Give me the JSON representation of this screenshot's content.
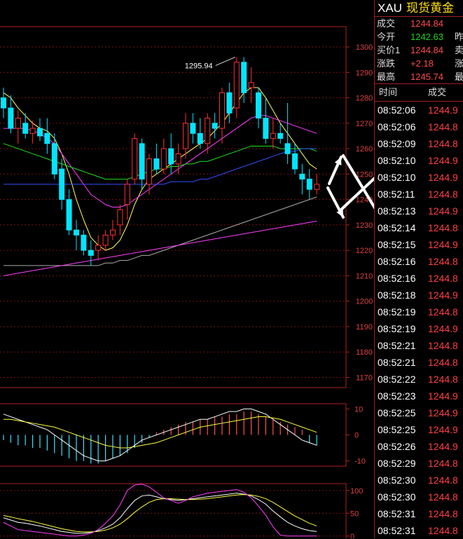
{
  "chart_data": [
    {
      "type": "candlestick",
      "symbol": "XAU",
      "price_axis_ticks": [
        1300,
        1290,
        1280,
        1270,
        1260,
        1250,
        1240,
        1230,
        1220,
        1210,
        1200,
        1190,
        1180,
        1170
      ],
      "ylim": [
        1166,
        1308
      ],
      "annotation": "1295.94",
      "candles": [
        [
          1280,
          1284,
          1272,
          1276
        ],
        [
          1276,
          1281,
          1266,
          1268
        ],
        [
          1268,
          1275,
          1262,
          1272
        ],
        [
          1270,
          1274,
          1264,
          1266
        ],
        [
          1266,
          1271,
          1262,
          1268
        ],
        [
          1268,
          1272,
          1263,
          1265
        ],
        [
          1266,
          1272,
          1258,
          1262
        ],
        [
          1262,
          1266,
          1248,
          1250
        ],
        [
          1252,
          1256,
          1236,
          1240
        ],
        [
          1240,
          1244,
          1226,
          1228
        ],
        [
          1228,
          1232,
          1220,
          1226
        ],
        [
          1226,
          1228,
          1218,
          1220
        ],
        [
          1220,
          1224,
          1214,
          1218
        ],
        [
          1220,
          1226,
          1216,
          1222
        ],
        [
          1222,
          1228,
          1220,
          1226
        ],
        [
          1226,
          1232,
          1224,
          1228
        ],
        [
          1230,
          1238,
          1226,
          1236
        ],
        [
          1238,
          1248,
          1232,
          1246
        ],
        [
          1248,
          1266,
          1246,
          1264
        ],
        [
          1262,
          1264,
          1244,
          1248
        ],
        [
          1246,
          1258,
          1242,
          1256
        ],
        [
          1256,
          1262,
          1250,
          1252
        ],
        [
          1252,
          1264,
          1250,
          1260
        ],
        [
          1260,
          1266,
          1250,
          1254
        ],
        [
          1254,
          1262,
          1250,
          1258
        ],
        [
          1260,
          1274,
          1256,
          1270
        ],
        [
          1270,
          1274,
          1262,
          1266
        ],
        [
          1266,
          1272,
          1260,
          1262
        ],
        [
          1262,
          1274,
          1258,
          1272
        ],
        [
          1270,
          1274,
          1264,
          1268
        ],
        [
          1268,
          1284,
          1262,
          1282
        ],
        [
          1282,
          1286,
          1270,
          1274
        ],
        [
          1276,
          1296,
          1272,
          1294
        ],
        [
          1294,
          1296,
          1278,
          1282
        ],
        [
          1284,
          1292,
          1278,
          1286
        ],
        [
          1282,
          1284,
          1268,
          1272
        ],
        [
          1272,
          1280,
          1262,
          1264
        ],
        [
          1264,
          1272,
          1260,
          1266
        ],
        [
          1266,
          1270,
          1262,
          1264
        ],
        [
          1262,
          1278,
          1254,
          1258
        ],
        [
          1258,
          1262,
          1250,
          1252
        ],
        [
          1250,
          1254,
          1242,
          1248
        ],
        [
          1248,
          1252,
          1240,
          1244
        ],
        [
          1244,
          1250,
          1242,
          1246
        ]
      ],
      "moving_averages": [
        {
          "color": "#ffff66",
          "values": [
            1282,
            1280,
            1276,
            1273,
            1270,
            1268,
            1267,
            1264,
            1258,
            1250,
            1240,
            1232,
            1225,
            1222,
            1220,
            1221,
            1224,
            1230,
            1238,
            1244,
            1248,
            1250,
            1252,
            1254,
            1256,
            1258,
            1260,
            1262,
            1264,
            1267,
            1270,
            1274,
            1278,
            1282,
            1284,
            1284,
            1280,
            1275,
            1270,
            1266,
            1262,
            1258,
            1254,
            1252
          ]
        },
        {
          "color": "#ff40ff",
          "values": [
            1268,
            1268,
            1268,
            1268,
            1267,
            1266,
            1264,
            1262,
            1258,
            1254,
            1250,
            1246,
            1242,
            1240,
            1238,
            1237,
            1237,
            1238,
            1240,
            1242,
            1244,
            1246,
            1248,
            1250,
            1252,
            1254,
            1256,
            1258,
            1260,
            1262,
            1264,
            1266,
            1268,
            1270,
            1272,
            1273,
            1273,
            1272,
            1271,
            1270,
            1269,
            1268,
            1267,
            1266
          ]
        },
        {
          "color": "#20e020",
          "values": [
            1262,
            1261,
            1260,
            1259,
            1258,
            1257,
            1256,
            1255,
            1254,
            1253,
            1252,
            1251,
            1250,
            1249,
            1248,
            1248,
            1248,
            1248,
            1249,
            1250,
            1251,
            1252,
            1252,
            1253,
            1253,
            1254,
            1254,
            1255,
            1255,
            1256,
            1257,
            1258,
            1259,
            1260,
            1261,
            1261,
            1261,
            1261,
            1260,
            1260,
            1260,
            1260,
            1260,
            1259
          ]
        },
        {
          "color": "#3050ff",
          "values": [
            1246,
            1246,
            1246,
            1246,
            1246,
            1246,
            1246,
            1246,
            1246,
            1246,
            1246,
            1246,
            1246,
            1246,
            1246,
            1246,
            1246,
            1246,
            1246,
            1246,
            1246,
            1246,
            1246,
            1247,
            1247,
            1247,
            1247,
            1248,
            1248,
            1249,
            1250,
            1251,
            1252,
            1253,
            1254,
            1255,
            1256,
            1257,
            1258,
            1259,
            1259,
            1260,
            1260,
            1260
          ]
        },
        {
          "color": "#aaaaaa",
          "values": [
            1214,
            1214,
            1214,
            1214,
            1214,
            1214,
            1214,
            1214,
            1214,
            1214,
            1214,
            1214,
            1214,
            1214,
            1215,
            1215,
            1216,
            1216,
            1217,
            1218,
            1218,
            1219,
            1220,
            1221,
            1222,
            1223,
            1224,
            1225,
            1226,
            1227,
            1228,
            1229,
            1230,
            1231,
            1232,
            1233,
            1234,
            1235,
            1236,
            1237,
            1238,
            1239,
            1240,
            1241
          ]
        },
        {
          "color": "#ff40ff",
          "values": [
            1210,
            1210.5,
            1211,
            1211.5,
            1212,
            1212.5,
            1213,
            1213.5,
            1214,
            1214.5,
            1215,
            1215.5,
            1216,
            1216.5,
            1217,
            1217.5,
            1218,
            1218.5,
            1219,
            1219.5,
            1220,
            1220.5,
            1221,
            1221.5,
            1222,
            1222.5,
            1223,
            1223.5,
            1224,
            1224.5,
            1225,
            1225.5,
            1226,
            1226.5,
            1227,
            1227.5,
            1228,
            1228.5,
            1229,
            1229.5,
            1230,
            1230.5,
            1231,
            1231.5
          ]
        }
      ]
    },
    {
      "type": "macd",
      "axis_ticks": [
        10,
        0,
        -10
      ],
      "ylim": [
        -12,
        12
      ],
      "hist": [
        -2,
        -3,
        -4,
        -4,
        -5,
        -5,
        -6,
        -7,
        -8,
        -9,
        -10,
        -10,
        -11,
        -11,
        -10,
        -9,
        -8,
        -7,
        -5,
        -3,
        -1,
        1,
        2,
        3,
        4,
        5,
        5,
        6,
        6,
        7,
        7,
        8,
        8,
        9,
        9,
        8,
        7,
        6,
        5,
        4,
        3,
        2,
        -3,
        -4
      ],
      "dif": [
        8,
        7,
        6,
        5,
        4,
        3,
        2,
        0,
        -2,
        -4,
        -6,
        -8,
        -9,
        -10,
        -10,
        -9,
        -8,
        -6,
        -4,
        -2,
        -1,
        0,
        1,
        2,
        3,
        4,
        5,
        6,
        6,
        7,
        8,
        9,
        9,
        10,
        10,
        9,
        8,
        6,
        4,
        2,
        0,
        -2,
        -3,
        -4
      ],
      "dea": [
        6,
        6,
        5.5,
        5,
        4.5,
        4,
        3.5,
        3,
        2,
        1,
        0,
        -1,
        -2,
        -3,
        -4,
        -4.5,
        -5,
        -5,
        -4.5,
        -4,
        -3.5,
        -3,
        -2,
        -1,
        0,
        1,
        2,
        3,
        3.5,
        4,
        4.5,
        5,
        5.5,
        6,
        6.5,
        7,
        7,
        6.5,
        6,
        5,
        4,
        3,
        2,
        1
      ]
    },
    {
      "type": "kdj",
      "axis_ticks": [
        100,
        50,
        0
      ],
      "ylim": [
        -5,
        115
      ],
      "k": [
        40,
        35,
        30,
        28,
        25,
        22,
        18,
        14,
        10,
        8,
        6,
        6,
        8,
        12,
        18,
        26,
        40,
        60,
        78,
        88,
        90,
        86,
        82,
        80,
        78,
        80,
        82,
        84,
        86,
        88,
        90,
        92,
        94,
        92,
        88,
        80,
        70,
        55,
        42,
        30,
        22,
        16,
        12,
        10
      ],
      "d": [
        45,
        42,
        38,
        35,
        32,
        28,
        24,
        20,
        16,
        13,
        10,
        9,
        9,
        10,
        13,
        18,
        26,
        38,
        52,
        64,
        74,
        80,
        82,
        82,
        81,
        80,
        80,
        81,
        82,
        84,
        86,
        88,
        90,
        91,
        90,
        87,
        82,
        74,
        64,
        54,
        44,
        36,
        28,
        22
      ],
      "j": [
        30,
        22,
        14,
        12,
        10,
        8,
        6,
        4,
        2,
        0,
        0,
        2,
        6,
        14,
        28,
        44,
        68,
        100,
        112,
        114,
        108,
        96,
        84,
        78,
        72,
        78,
        86,
        90,
        94,
        96,
        98,
        100,
        102,
        96,
        84,
        66,
        46,
        20,
        2,
        0,
        0,
        0,
        0,
        0
      ]
    }
  ],
  "quote": {
    "symbol": "XAU",
    "name": "现货黄金",
    "rows": [
      {
        "label": "成交",
        "value": "1244.84",
        "value_color": "#ff4a4a",
        "label2": ""
      },
      {
        "label": "今开",
        "value": "1242.63",
        "value_color": "#20d020",
        "label2": "昨"
      },
      {
        "label": "买价1",
        "value": "1244.84",
        "value_color": "#ff4a4a",
        "label2": "卖"
      },
      {
        "label": "涨跌",
        "value": "+2.18",
        "value_color": "#ff4a4a",
        "label2": "涨"
      },
      {
        "label": "最高",
        "value": "1245.74",
        "value_color": "#ff4a4a",
        "label2": "最"
      }
    ]
  },
  "ticks": {
    "header_time": "时间",
    "header_price": "成交",
    "rows": [
      {
        "time": "08:52:06",
        "price": "1244.9"
      },
      {
        "time": "08:52:06",
        "price": "1244.8"
      },
      {
        "time": "08:52:09",
        "price": "1244.8"
      },
      {
        "time": "08:52:10",
        "price": "1244.9"
      },
      {
        "time": "08:52:10",
        "price": "1244.9"
      },
      {
        "time": "08:52:11",
        "price": "1244.8"
      },
      {
        "time": "08:52:13",
        "price": "1244.9"
      },
      {
        "time": "08:52:14",
        "price": "1244.8"
      },
      {
        "time": "08:52:15",
        "price": "1244.9"
      },
      {
        "time": "08:52:16",
        "price": "1244.8"
      },
      {
        "time": "08:52:16",
        "price": "1244.8"
      },
      {
        "time": "08:52:18",
        "price": "1244.9"
      },
      {
        "time": "08:52:19",
        "price": "1244.8"
      },
      {
        "time": "08:52:19",
        "price": "1244.9"
      },
      {
        "time": "08:52:21",
        "price": "1244.8"
      },
      {
        "time": "08:52:21",
        "price": "1244.8"
      },
      {
        "time": "08:52:22",
        "price": "1244.8"
      },
      {
        "time": "08:52:23",
        "price": "1244.9"
      },
      {
        "time": "08:52:25",
        "price": "1244.9"
      },
      {
        "time": "08:52:25",
        "price": "1244.9"
      },
      {
        "time": "08:52:26",
        "price": "1244.9"
      },
      {
        "time": "08:52:29",
        "price": "1244.8"
      },
      {
        "time": "08:52:30",
        "price": "1244.8"
      },
      {
        "time": "08:52:30",
        "price": "1244.8"
      },
      {
        "time": "08:52:31",
        "price": "1244.8"
      },
      {
        "time": "08:52:31",
        "price": "1244.8"
      }
    ]
  }
}
